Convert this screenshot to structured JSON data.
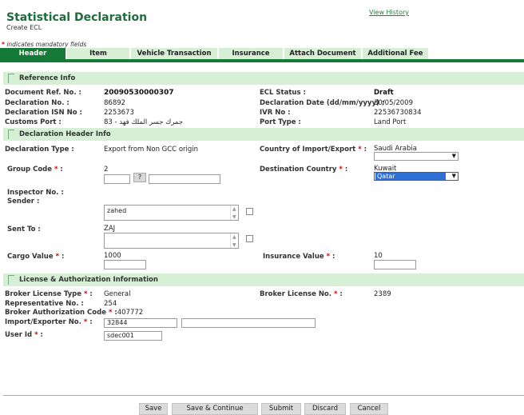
{
  "header": {
    "title": "Statistical Declaration",
    "subtitle": "Create ECL",
    "view_history": "View History",
    "mandatory_note": "indicates mandatory fields"
  },
  "tabs": [
    "Header",
    "Item",
    "Vehicle Transaction",
    "Insurance",
    "Attach Document",
    "Additional Fee"
  ],
  "sections": {
    "reference": "Reference Info",
    "declaration_header": "Declaration Header Info",
    "license": "License & Authorization Information"
  },
  "reference": {
    "doc_ref_label": "Document Ref. No. :",
    "doc_ref_value": "20090530000307",
    "decl_no_label": "Declaration No. :",
    "decl_no_value": "86892",
    "isn_label": "Declaration ISN No :",
    "isn_value": "2253673",
    "customs_port_label": "Customs Port :",
    "customs_port_value": "83 - جمرك جسر الملك فهد",
    "ecl_status_label": "ECL Status :",
    "ecl_status_value": "Draft",
    "decl_date_label": "Declaration Date (dd/mm/yyyy) :",
    "decl_date_value": "30/05/2009",
    "ivr_label": "IVR No :",
    "ivr_value": "22536730834",
    "port_type_label": "Port Type :",
    "port_type_value": "Land Port"
  },
  "decl_header": {
    "decl_type_label": "Declaration Type :",
    "decl_type_value": "Export from Non GCC origin",
    "country_label": "Country of Import/Export",
    "country_value": "Saudi Arabia",
    "group_code_label": "Group Code",
    "group_code_value": "2",
    "question": "?",
    "dest_country_label": "Destination Country",
    "dest_country_value": "Kuwait",
    "dest_country_selected": "Qatar",
    "inspector_label": "Inspector No. :",
    "sender_label": "Sender :",
    "sender_value": "zahed",
    "sent_to_label": "Sent To :",
    "sent_to_value": "ZAJ",
    "cargo_value_label": "Cargo Value",
    "cargo_value": "1000",
    "insurance_value_label": "Insurance Value",
    "insurance_value": "10"
  },
  "license": {
    "broker_type_label": "Broker License Type",
    "broker_type_value": "General",
    "broker_license_label": "Broker License No.",
    "broker_license_value": "2389",
    "rep_label": "Representative No. :",
    "rep_value": "254",
    "auth_code_label": "Broker Authorization Code",
    "auth_code_value": "407772",
    "importer_label": "Import/Exporter No.",
    "importer_value": "32844",
    "user_id_label": "User Id",
    "user_id_value": "sdec001"
  },
  "buttons": {
    "save": "Save",
    "save_continue": "Save & Continue",
    "submit": "Submit",
    "discard": "Discard",
    "cancel": "Cancel"
  },
  "colors": {
    "brand_green": "#157a38",
    "title_green": "#1f6b3a",
    "section_bg": "#d6efd5",
    "required": "#d40000"
  }
}
